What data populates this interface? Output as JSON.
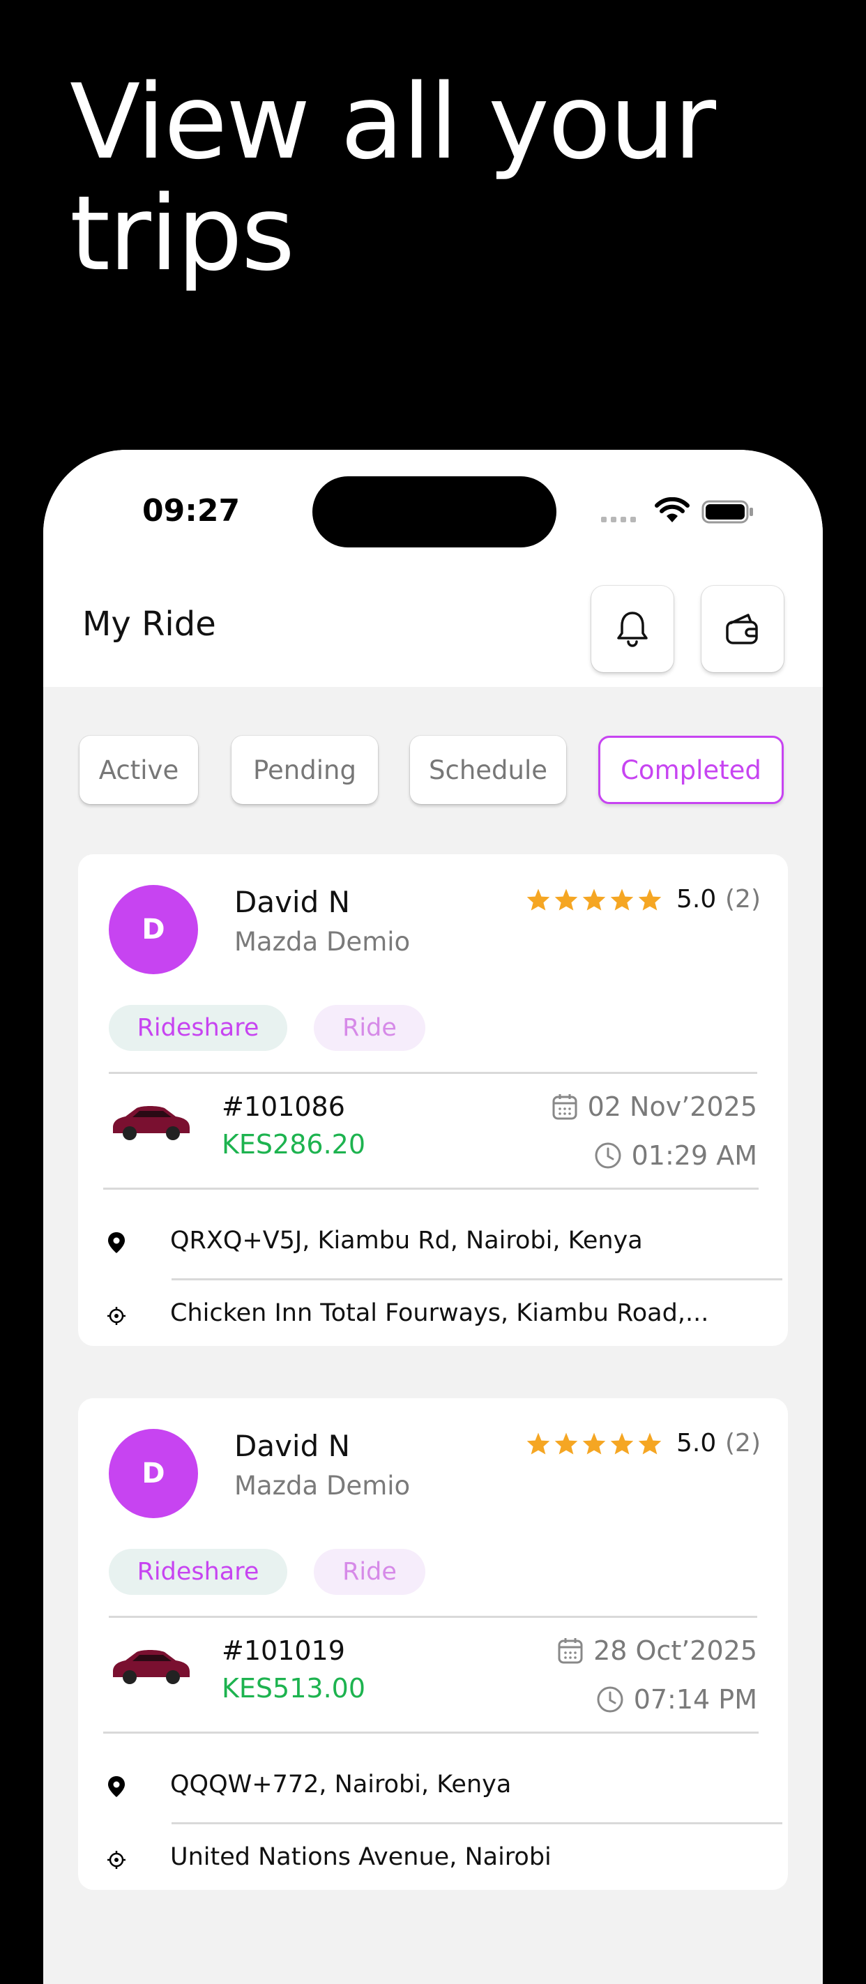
{
  "headline": "View all your trips",
  "status_bar": {
    "time": "09:27"
  },
  "header": {
    "title": "My Ride"
  },
  "icons": {
    "bell": "bell-icon",
    "wallet": "wallet-icon"
  },
  "tabs": [
    {
      "label": "Active",
      "selected": false
    },
    {
      "label": "Pending",
      "selected": false
    },
    {
      "label": "Schedule",
      "selected": false
    },
    {
      "label": "Completed",
      "selected": true
    }
  ],
  "colors": {
    "accent": "#c744f1",
    "price": "#1db34f",
    "star": "#f5a623"
  },
  "rides": [
    {
      "avatar_letter": "D",
      "driver_name": "David N",
      "car_model": "Mazda Demio",
      "rating": "5.0",
      "rating_count": "(2)",
      "stars": 5,
      "tag_primary": "Rideshare",
      "tag_secondary": "Ride",
      "ride_id": "#101086",
      "price": "KES286.20",
      "date": "02 Nov’2025",
      "time": "01:29 AM",
      "pickup": "QRXQ+V5J, Kiambu Rd, Nairobi, Kenya",
      "dropoff": "Chicken Inn Total Fourways, Kiambu Road,..."
    },
    {
      "avatar_letter": "D",
      "driver_name": "David N",
      "car_model": "Mazda Demio",
      "rating": "5.0",
      "rating_count": "(2)",
      "stars": 5,
      "tag_primary": "Rideshare",
      "tag_secondary": "Ride",
      "ride_id": "#101019",
      "price": "KES513.00",
      "date": "28 Oct’2025",
      "time": "07:14 PM",
      "pickup": "QQQW+772, Nairobi, Kenya",
      "dropoff": "United Nations Avenue, Nairobi"
    }
  ]
}
